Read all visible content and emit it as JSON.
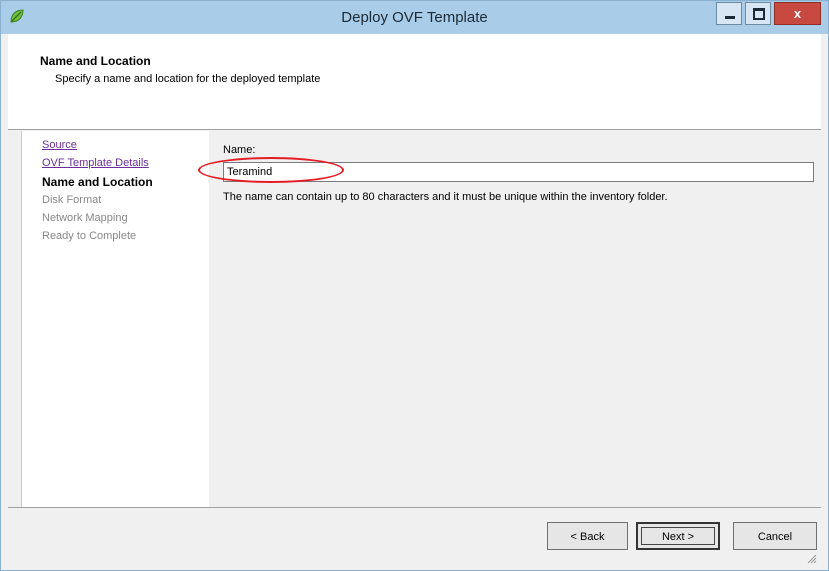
{
  "window": {
    "title": "Deploy OVF Template",
    "close_label": "x",
    "icons": {
      "app": "vsphere-leaf-icon",
      "minimize": "minimize-icon",
      "maximize": "maximize-icon",
      "close": "close-icon",
      "grip": "resize-grip-icon"
    }
  },
  "header": {
    "title": "Name and Location",
    "subtitle": "Specify a name and location for the deployed template"
  },
  "sidebar": {
    "items": [
      {
        "label": "Source",
        "state": "link"
      },
      {
        "label": "OVF Template Details",
        "state": "link"
      },
      {
        "label": "Name and Location",
        "state": "current"
      },
      {
        "label": "Disk Format",
        "state": "disabled"
      },
      {
        "label": "Network Mapping",
        "state": "disabled"
      },
      {
        "label": "Ready to Complete",
        "state": "disabled"
      }
    ]
  },
  "content": {
    "name_label": "Name:",
    "name_value": "Teramind",
    "hint": "The name can contain up to 80 characters and it must be unique within the inventory folder."
  },
  "footer": {
    "back_label": "< Back",
    "next_label": "Next >",
    "cancel_label": "Cancel"
  },
  "colors": {
    "titlebar": "#a9cde9",
    "link": "#6a2f9a",
    "annotation": "#e41c24"
  }
}
